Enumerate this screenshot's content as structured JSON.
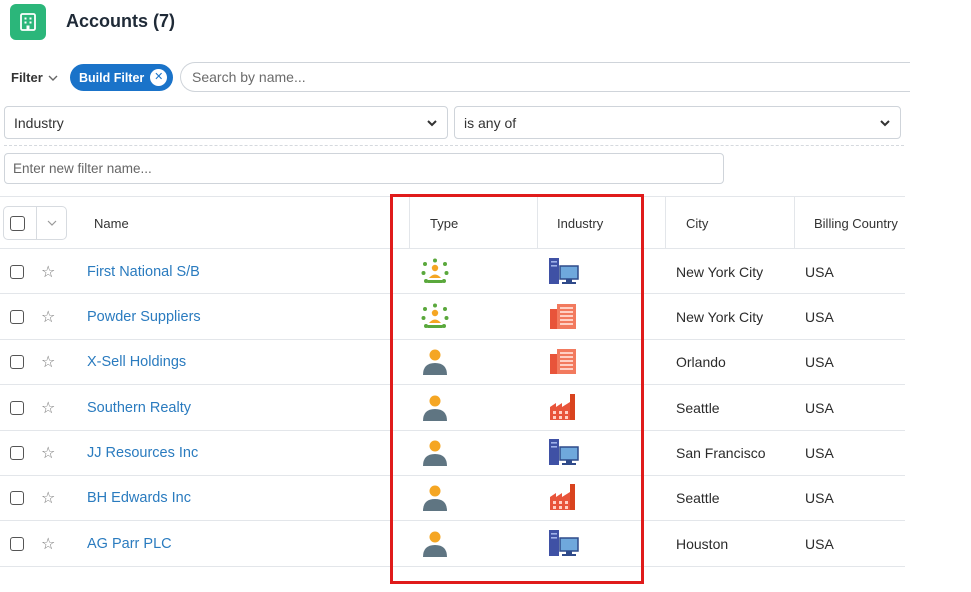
{
  "header": {
    "title": "Accounts (7)",
    "icon": "building-icon"
  },
  "filter": {
    "label": "Filter",
    "build_filter_label": "Build Filter",
    "search_placeholder": "Search by name...",
    "field_select_value": "Industry",
    "operator_select_value": "is any of",
    "filter_name_placeholder": "Enter new filter name..."
  },
  "table": {
    "columns": [
      "Name",
      "Type",
      "Industry",
      "City",
      "Billing Country"
    ],
    "rows": [
      {
        "name": "First National S/B",
        "type_icon": "group-icon",
        "industry_icon": "computer-icon",
        "city": "New York City",
        "country": "USA"
      },
      {
        "name": "Powder Suppliers",
        "type_icon": "group-icon",
        "industry_icon": "office-building-icon",
        "city": "New York City",
        "country": "USA"
      },
      {
        "name": "X-Sell Holdings",
        "type_icon": "person-icon",
        "industry_icon": "office-building-icon",
        "city": "Orlando",
        "country": "USA"
      },
      {
        "name": "Southern Realty",
        "type_icon": "person-icon",
        "industry_icon": "factory-icon",
        "city": "Seattle",
        "country": "USA"
      },
      {
        "name": "JJ Resources Inc",
        "type_icon": "person-icon",
        "industry_icon": "computer-icon",
        "city": "San Francisco",
        "country": "USA"
      },
      {
        "name": "BH Edwards Inc",
        "type_icon": "person-icon",
        "industry_icon": "factory-icon",
        "city": "Seattle",
        "country": "USA"
      },
      {
        "name": "AG Parr PLC",
        "type_icon": "person-icon",
        "industry_icon": "computer-icon",
        "city": "Houston",
        "country": "USA"
      }
    ]
  },
  "colors": {
    "accent": "#1a73c9",
    "app_icon": "#2bb67a",
    "link": "#2a7bbf",
    "highlight": "#e01b1b"
  }
}
